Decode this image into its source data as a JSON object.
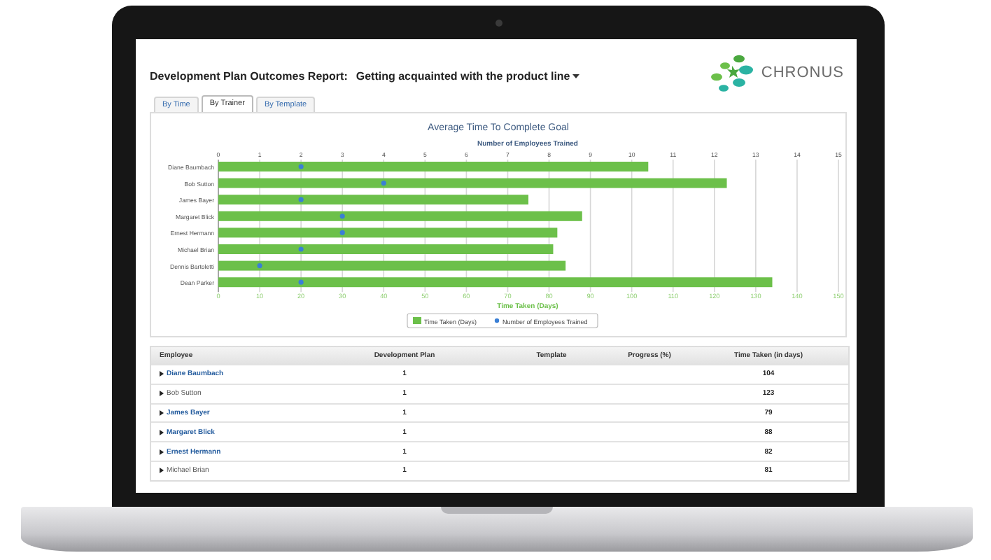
{
  "report": {
    "title": "Development Plan Outcomes Report:",
    "plan": "Getting acquainted with the product line",
    "logo_text": "CHRONUS"
  },
  "tabs": [
    {
      "label": "By Time",
      "selected": false
    },
    {
      "label": "By Trainer",
      "selected": true
    },
    {
      "label": "By Template",
      "selected": false
    }
  ],
  "chart": {
    "chart_data": {
      "type": "bar",
      "orientation": "horizontal",
      "title": "Average Time To Complete Goal",
      "xlabel": "Time Taken (Days)",
      "categories": [
        "Diane Baumbach",
        "Bob Sutton",
        "James Bayer",
        "Margaret Blick",
        "Ernest Hermann",
        "Michael Brian",
        "Dennis Bartoletti",
        "Dean Parker"
      ],
      "series": [
        {
          "name": "Time Taken (Days)",
          "color": "#6cc04a",
          "values": [
            104,
            123,
            75,
            88,
            82,
            81,
            84,
            134
          ]
        }
      ],
      "xlim": [
        0,
        150
      ],
      "xticks": [
        0,
        10,
        20,
        30,
        40,
        50,
        60,
        70,
        80,
        90,
        100,
        110,
        120,
        130,
        140,
        150
      ],
      "grid": true
    },
    "overlay": {
      "chart_data": {
        "type": "scatter",
        "orientation": "horizontal",
        "xlabel": "Number of Employees Trained",
        "series": [
          {
            "name": "Number of Employees Trained",
            "color": "#3a7fd5",
            "values": [
              2,
              4,
              2,
              3,
              3,
              2,
              1,
              2
            ]
          }
        ],
        "xlim": [
          0,
          15
        ],
        "xticks": [
          0,
          1,
          2,
          3,
          4,
          5,
          6,
          7,
          8,
          9,
          10,
          11,
          12,
          13,
          14,
          15
        ]
      }
    }
  },
  "table": {
    "columns": [
      "Employee",
      "Development Plan",
      "Template",
      "Progress (%)",
      "Time Taken (in days)"
    ],
    "rows": [
      {
        "employee": "Diane Baumbach",
        "link": true,
        "plan": "1",
        "time": "104"
      },
      {
        "employee": "Bob Sutton",
        "link": false,
        "plan": "1",
        "time": "123"
      },
      {
        "employee": "James Bayer",
        "link": true,
        "plan": "1",
        "time": "79"
      },
      {
        "employee": "Margaret Blick",
        "link": true,
        "plan": "1",
        "time": "88"
      },
      {
        "employee": "Ernest Hermann",
        "link": true,
        "plan": "1",
        "time": "82"
      },
      {
        "employee": "Michael Brian",
        "link": false,
        "plan": "1",
        "time": "81"
      }
    ]
  }
}
